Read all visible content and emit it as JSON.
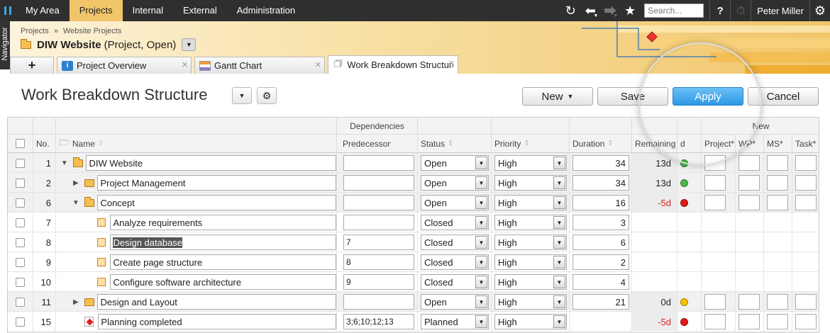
{
  "topnav": {
    "tabs": [
      "My Area",
      "Projects",
      "Internal",
      "External",
      "Administration"
    ],
    "active_tab": "Projects",
    "search_placeholder": "Search...",
    "user": "Peter Miller"
  },
  "navigator_label": "Navigator",
  "breadcrumb": [
    "Projects",
    "»",
    "Website Projects"
  ],
  "project": {
    "name": "DIW Website",
    "meta": "(Project, Open)"
  },
  "tabs": [
    {
      "label": "Project Overview",
      "icon": "info-icon"
    },
    {
      "label": "Gantt Chart",
      "icon": "gantt-icon"
    },
    {
      "label": "Work Breakdown Structure",
      "icon": "wbs-icon"
    }
  ],
  "page_title": "Work Breakdown Structure",
  "buttons": {
    "new": "New",
    "save": "Save",
    "apply": "Apply",
    "cancel": "Cancel"
  },
  "grid": {
    "group_headers": {
      "dependencies": "Dependencies",
      "new": "New"
    },
    "columns": {
      "no": "No.",
      "name": "Name",
      "predecessor": "Predecessor",
      "status": "Status",
      "priority": "Priority",
      "duration": "Duration",
      "remaining": "Remaining",
      "d": "d",
      "project": "Project*",
      "wp": "WP*",
      "ms": "MS*",
      "task": "Task*"
    },
    "rows": [
      {
        "no": "1",
        "level": 0,
        "toggle": "▼",
        "icon": "folder-open",
        "name": "DIW Website",
        "pred": "",
        "status": "Open",
        "priority": "High",
        "duration": "34",
        "remaining": "13d",
        "rem_neg": false,
        "dot": "green",
        "summary": true
      },
      {
        "no": "2",
        "level": 1,
        "toggle": "▶",
        "icon": "folder",
        "name": "Project Management",
        "pred": "",
        "status": "Open",
        "priority": "High",
        "duration": "34",
        "remaining": "13d",
        "rem_neg": false,
        "dot": "green",
        "summary": true
      },
      {
        "no": "6",
        "level": 1,
        "toggle": "▼",
        "icon": "folder-open",
        "name": "Concept",
        "pred": "",
        "status": "Open",
        "priority": "High",
        "duration": "16",
        "remaining": "-5d",
        "rem_neg": true,
        "dot": "red",
        "summary": true
      },
      {
        "no": "7",
        "level": 2,
        "toggle": "",
        "icon": "task",
        "name": "Analyze requirements",
        "pred": "",
        "status": "Closed",
        "priority": "High",
        "duration": "3",
        "remaining": "",
        "rem_neg": false,
        "dot": "",
        "summary": false
      },
      {
        "no": "8",
        "level": 2,
        "toggle": "",
        "icon": "task",
        "name": "Design database",
        "pred": "7",
        "status": "Closed",
        "priority": "High",
        "duration": "6",
        "remaining": "",
        "rem_neg": false,
        "dot": "",
        "summary": false,
        "selected": true
      },
      {
        "no": "9",
        "level": 2,
        "toggle": "",
        "icon": "task",
        "name": "Create page structure",
        "pred": "8",
        "status": "Closed",
        "priority": "High",
        "duration": "2",
        "remaining": "",
        "rem_neg": false,
        "dot": "",
        "summary": false
      },
      {
        "no": "10",
        "level": 2,
        "toggle": "",
        "icon": "task",
        "name": "Configure software architecture",
        "pred": "9",
        "status": "Closed",
        "priority": "High",
        "duration": "4",
        "remaining": "",
        "rem_neg": false,
        "dot": "",
        "summary": false
      },
      {
        "no": "11",
        "level": 1,
        "toggle": "▶",
        "icon": "folder",
        "name": "Design and Layout",
        "pred": "",
        "status": "Open",
        "priority": "High",
        "duration": "21",
        "remaining": "0d",
        "rem_neg": false,
        "dot": "yellow",
        "summary": true
      },
      {
        "no": "15",
        "level": 1,
        "toggle": "",
        "icon": "milestone",
        "name": "Planning completed",
        "pred": "3;6;10;12;13",
        "status": "Planned",
        "priority": "High",
        "duration": "",
        "remaining": "-5d",
        "rem_neg": true,
        "dot": "red",
        "summary": false
      }
    ]
  },
  "colors": {
    "accent": "#f1c56a",
    "apply": "#2d97e6",
    "negative": "#d22222"
  }
}
